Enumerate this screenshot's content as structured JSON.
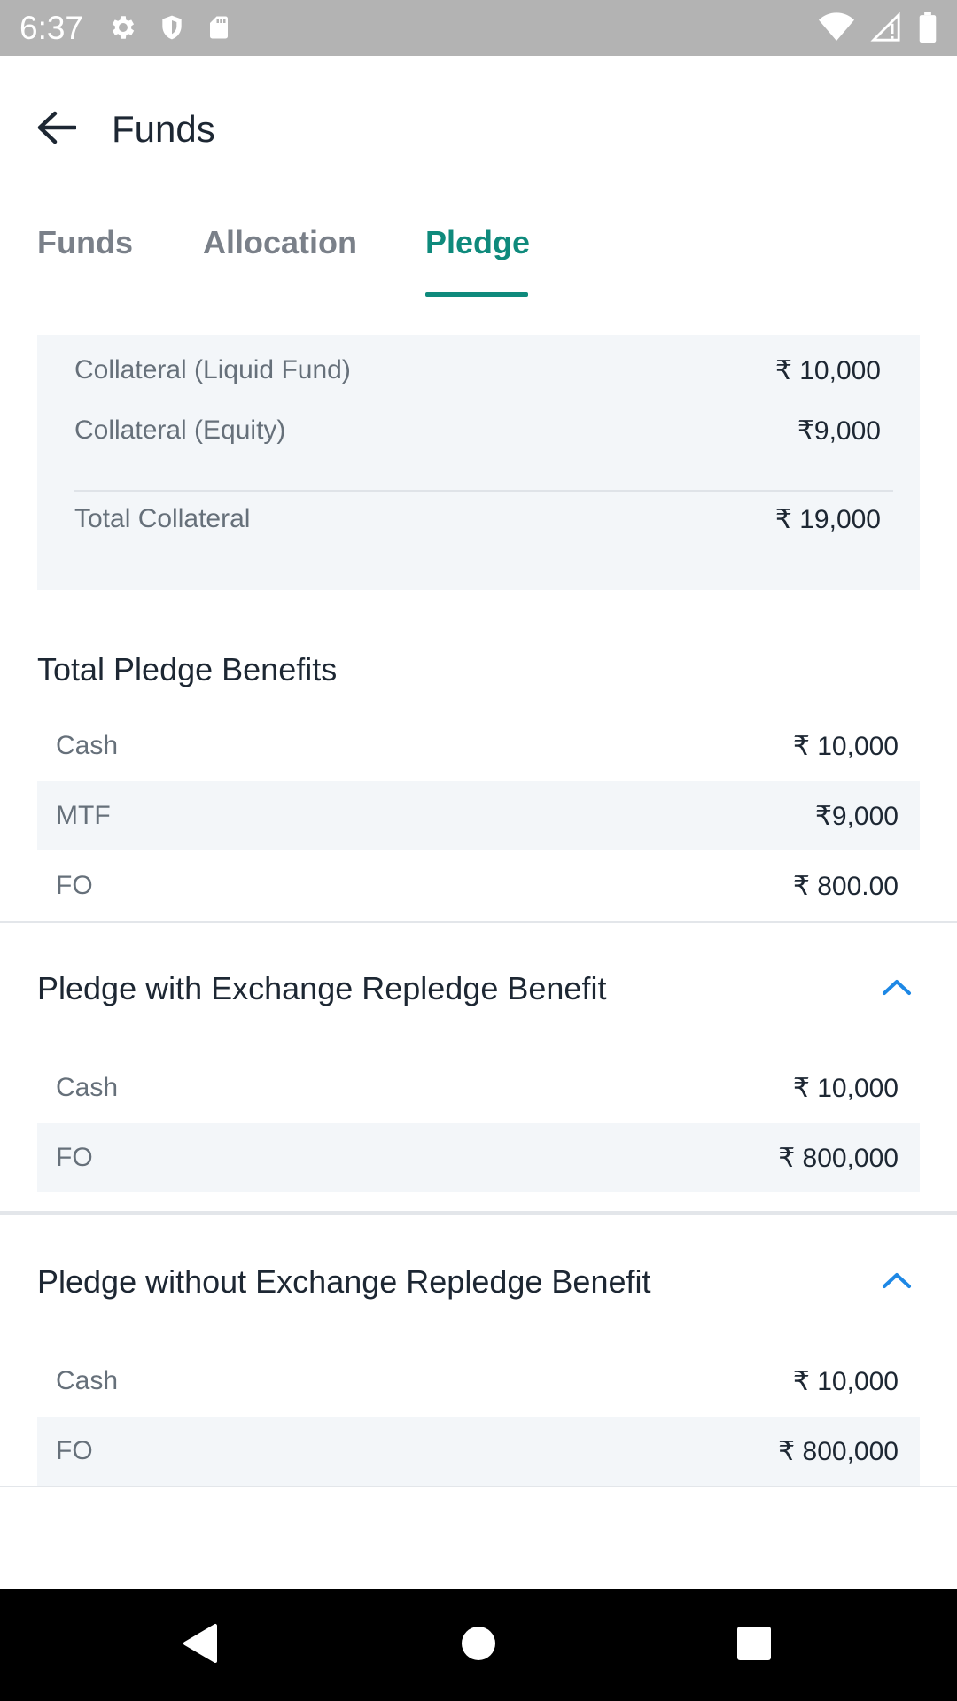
{
  "status_bar": {
    "time": "6:37",
    "icons_left": [
      "gear-icon",
      "shield-icon",
      "sd-card-icon"
    ],
    "icons_right": [
      "wifi-icon",
      "signal-icon",
      "battery-icon"
    ]
  },
  "app_bar": {
    "title": "Funds",
    "back_icon": "arrow-left-icon"
  },
  "tabs": [
    {
      "label": "Funds",
      "active": false
    },
    {
      "label": "Allocation",
      "active": false
    },
    {
      "label": "Pledge",
      "active": true
    }
  ],
  "collateral": {
    "rows": [
      {
        "label": "Collateral (Liquid Fund)",
        "value": "₹ 10,000"
      },
      {
        "label": "Collateral (Equity)",
        "value": "₹9,000"
      }
    ],
    "total": {
      "label": "Total Collateral",
      "value": "₹ 19,000"
    }
  },
  "total_pledge_benefits": {
    "title": "Total Pledge Benefits",
    "rows": [
      {
        "label": "Cash",
        "value": "₹ 10,000"
      },
      {
        "label": "MTF",
        "value": "₹9,000"
      },
      {
        "label": "FO",
        "value": "₹ 800.00"
      }
    ]
  },
  "with_repledge": {
    "title": "Pledge with Exchange Repledge Benefit",
    "expanded": true,
    "rows": [
      {
        "label": "Cash",
        "value": "₹ 10,000"
      },
      {
        "label": "FO",
        "value": "₹ 800,000"
      }
    ]
  },
  "without_repledge": {
    "title": "Pledge without Exchange Repledge Benefit",
    "expanded": true,
    "rows": [
      {
        "label": "Cash",
        "value": "₹ 10,000"
      },
      {
        "label": "FO",
        "value": "₹ 800,000"
      }
    ]
  },
  "colors": {
    "accent": "#0f8a7c",
    "chevron": "#1e88e5",
    "shaded_row": "#f3f6f9"
  }
}
